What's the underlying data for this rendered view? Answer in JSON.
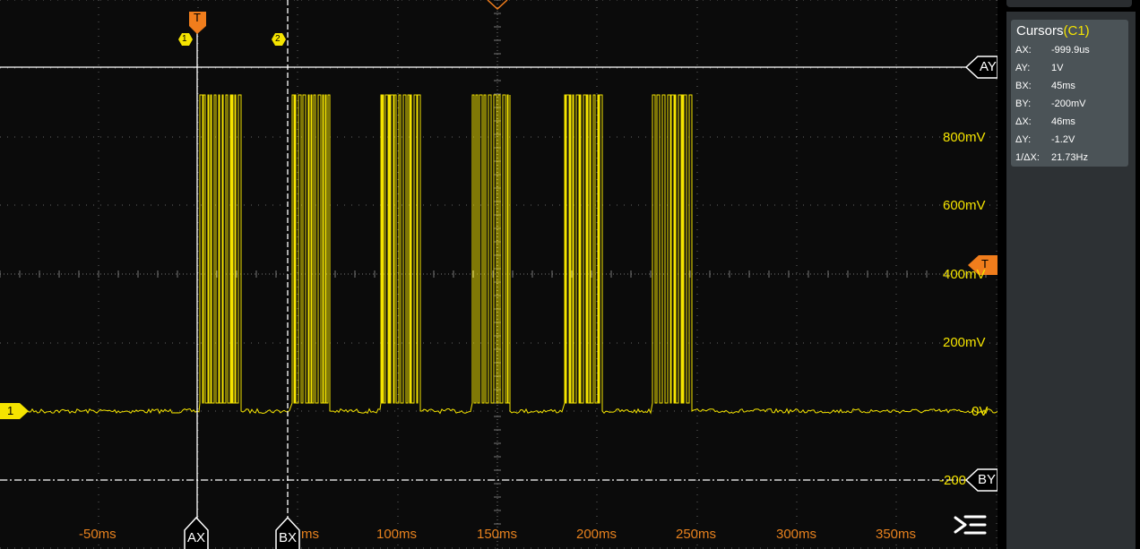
{
  "waveform": {
    "y_labels": [
      "800mV",
      "600mV",
      "400mV",
      "200mV",
      "0V",
      "-200"
    ],
    "x_labels": [
      "-50ms",
      "ms",
      "100ms",
      "150ms",
      "200ms",
      "250ms",
      "300ms",
      "350ms"
    ],
    "trigger_marker_top": "T",
    "trigger_marker_right": "T",
    "channel_marker": "1",
    "cursor_ax": "AX",
    "cursor_bx": "BX",
    "cursor_ay": "AY",
    "cursor_by": "BY",
    "cursor_num_1": "1",
    "cursor_num_2": "2",
    "signal_color": "#f5e400",
    "cursor_color": "#ffffff",
    "trigger_color": "#f07d1c",
    "menu_icon": "menu-icon"
  },
  "cursors_panel": {
    "title": "Cursors",
    "channel": "(C1)",
    "rows": [
      {
        "key": "AX:",
        "value": "-999.9us"
      },
      {
        "key": "AY:",
        "value": "1V"
      },
      {
        "key": "BX:",
        "value": "45ms"
      },
      {
        "key": "BY:",
        "value": "-200mV"
      },
      {
        "key": "ΔX:",
        "value": "46ms"
      },
      {
        "key": "ΔY:",
        "value": "-1.2V"
      },
      {
        "key": "1/ΔX:",
        "value": "21.73Hz"
      }
    ]
  }
}
